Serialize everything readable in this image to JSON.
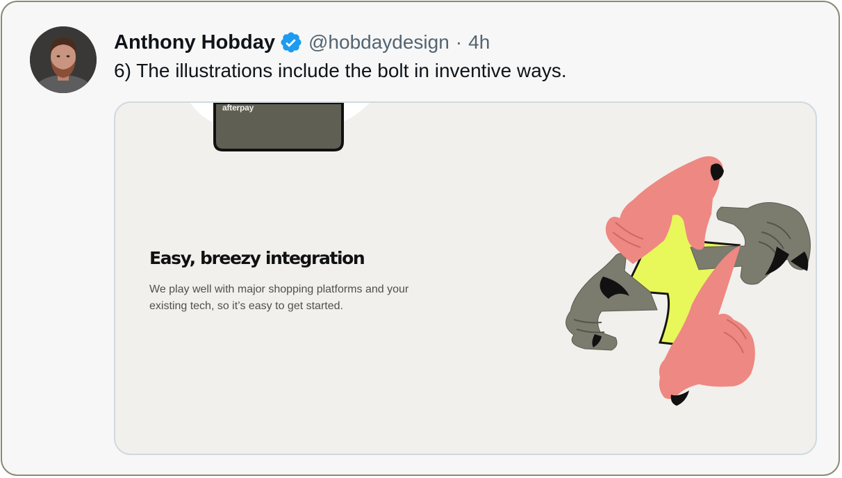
{
  "tweet": {
    "display_name": "Anthony Hobday",
    "handle": "@hobdaydesign",
    "separator": "·",
    "time": "4h",
    "text": "6) The illustrations include the bolt in inventive ways."
  },
  "media": {
    "phone_brand": "afterpay",
    "heading": "Easy, breezy integration",
    "body": "We play well with major shopping platforms and your existing tech, so it’s easy to get started."
  },
  "colors": {
    "card_border": "#8a8a74",
    "verified": "#1d9bf0",
    "hand_pink": "#ee8882",
    "hand_gray": "#7b7b6e",
    "bolt_yellow": "#e8f75a",
    "phone_body": "#5f5f54"
  },
  "icons": {
    "verified": "verified-badge-icon"
  }
}
